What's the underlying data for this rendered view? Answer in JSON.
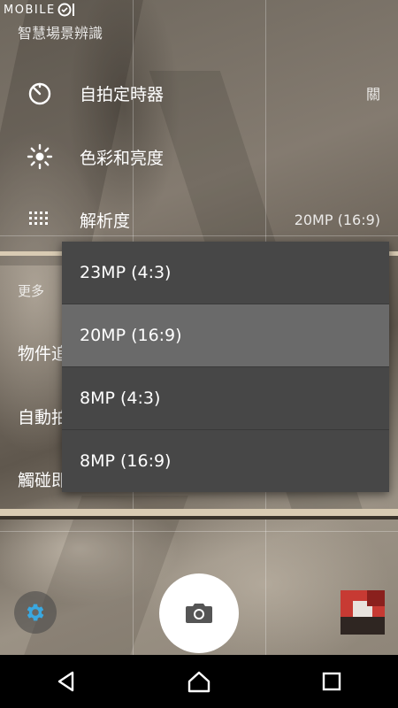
{
  "watermark": {
    "brand": "MOBILE"
  },
  "menu": {
    "top_item": "智慧場景辨識",
    "self_timer": {
      "label": "自拍定時器",
      "value": "關",
      "icon": "timer-icon"
    },
    "color_brightness": {
      "label": "色彩和亮度",
      "icon": "brightness-icon"
    },
    "resolution": {
      "label": "解析度",
      "value": "20MP (16:9)",
      "icon": "resolution-grid-icon"
    },
    "more_section": "更多",
    "hidden_rows": [
      "物件追",
      "自動拍",
      "觸碰即"
    ]
  },
  "dropdown": {
    "options": [
      "23MP (4:3)",
      "20MP (16:9)",
      "8MP (4:3)",
      "8MP (16:9)"
    ],
    "selected": "20MP (16:9)"
  },
  "controls": {
    "settings_icon": "gear-icon",
    "shutter_icon": "camera-icon",
    "thumbnail": "last-photo-thumbnail"
  },
  "navbar": {
    "icons": [
      "back-icon",
      "home-icon",
      "recents-icon"
    ]
  },
  "colors": {
    "accent": "#3aa8e0",
    "dropdown_bg": "#474747",
    "selected_bg": "#6a6a6a"
  }
}
